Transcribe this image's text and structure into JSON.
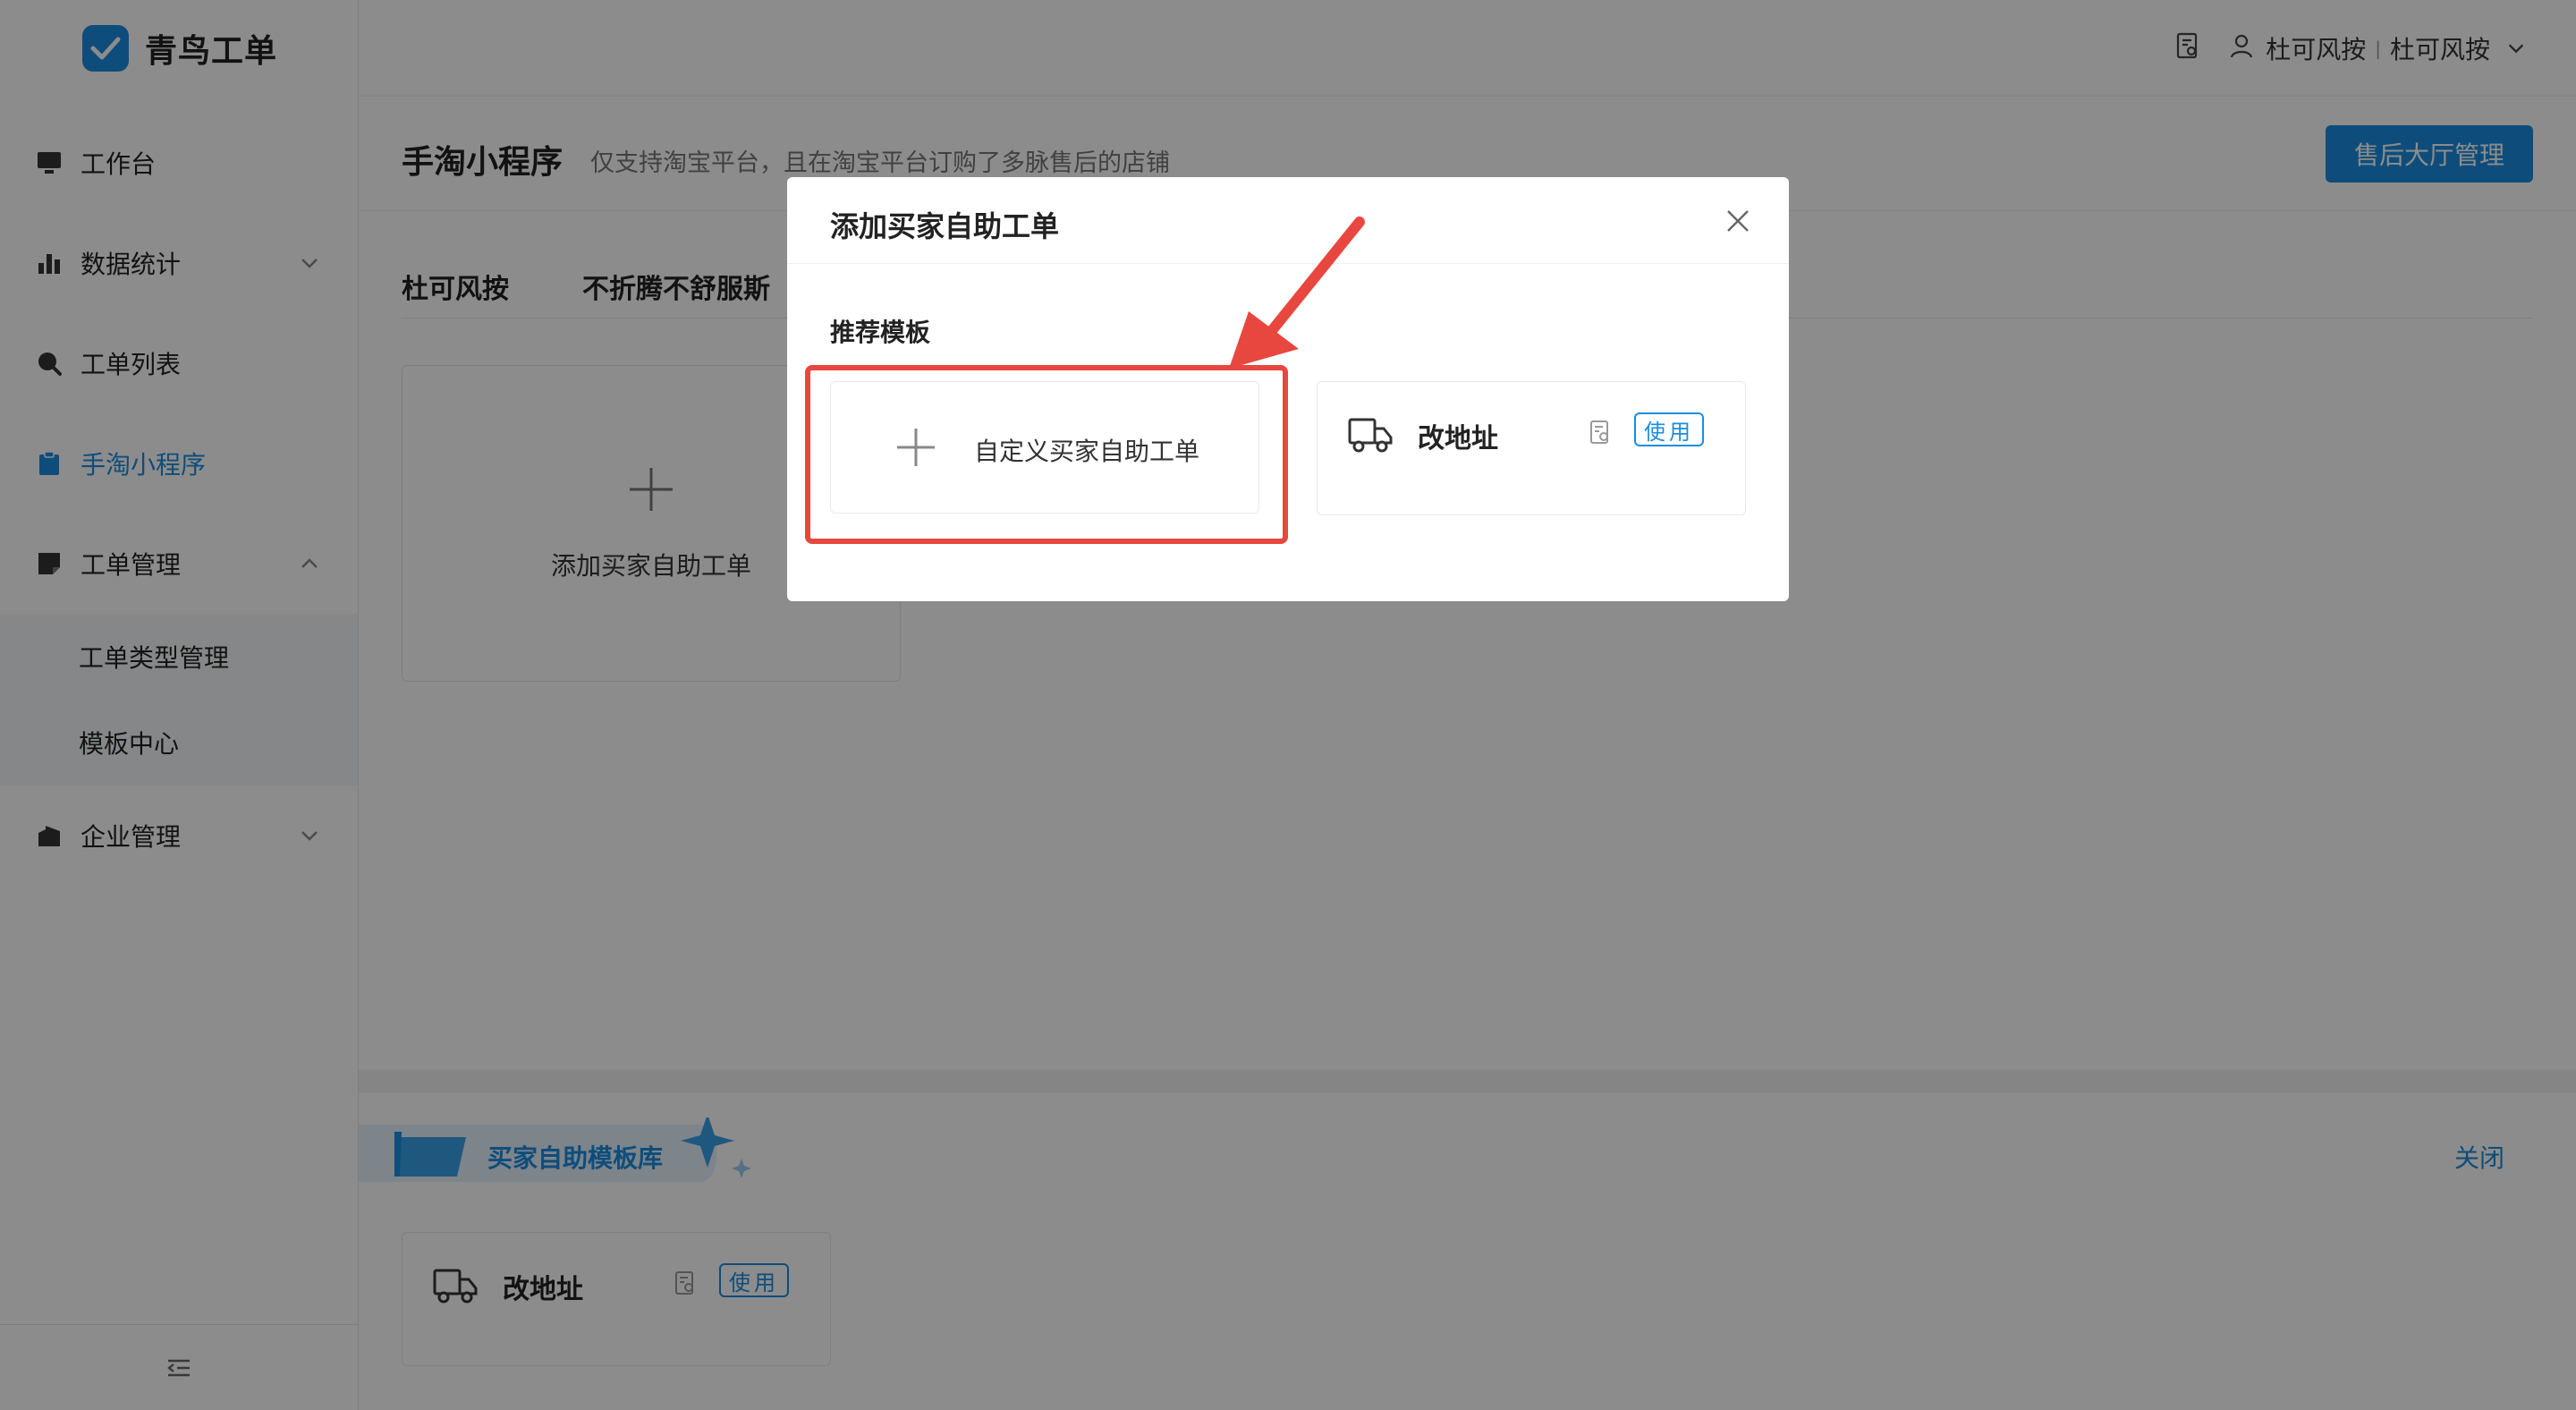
{
  "app": {
    "name": "青鸟工单"
  },
  "sidebar": {
    "items": [
      {
        "label": "工作台",
        "icon": "monitor-icon"
      },
      {
        "label": "数据统计",
        "icon": "bar-chart-icon"
      },
      {
        "label": "工单列表",
        "icon": "search-icon"
      },
      {
        "label": "手淘小程序",
        "icon": "clipboard-icon"
      },
      {
        "label": "工单管理",
        "icon": "note-icon"
      },
      {
        "label": "企业管理",
        "icon": "building-icon"
      }
    ],
    "submenu": [
      {
        "label": "工单类型管理"
      },
      {
        "label": "模板中心"
      }
    ]
  },
  "header": {
    "user": "杜可风按",
    "org": "杜可风按"
  },
  "page": {
    "title": "手淘小程序",
    "subtitle": "仅支持淘宝平台，且在淘宝平台订购了多脉售后的店铺",
    "primary_button": "售后大厅管理"
  },
  "shops": {
    "tabs": [
      {
        "label": "杜可风按"
      },
      {
        "label": "不折腾不舒服斯"
      }
    ],
    "add_card_label": "添加买家自助工单"
  },
  "library": {
    "title": "买家自助模板库",
    "close_label": "关闭",
    "templates": [
      {
        "name": "改地址",
        "use_label": "使用"
      }
    ]
  },
  "modal": {
    "title": "添加买家自助工单",
    "section_label": "推荐模板",
    "custom_label": "自定义买家自助工单",
    "templates": [
      {
        "name": "改地址",
        "use_label": "使用"
      }
    ]
  },
  "colors": {
    "primary": "#1a8de0",
    "highlight": "#e8473f"
  }
}
